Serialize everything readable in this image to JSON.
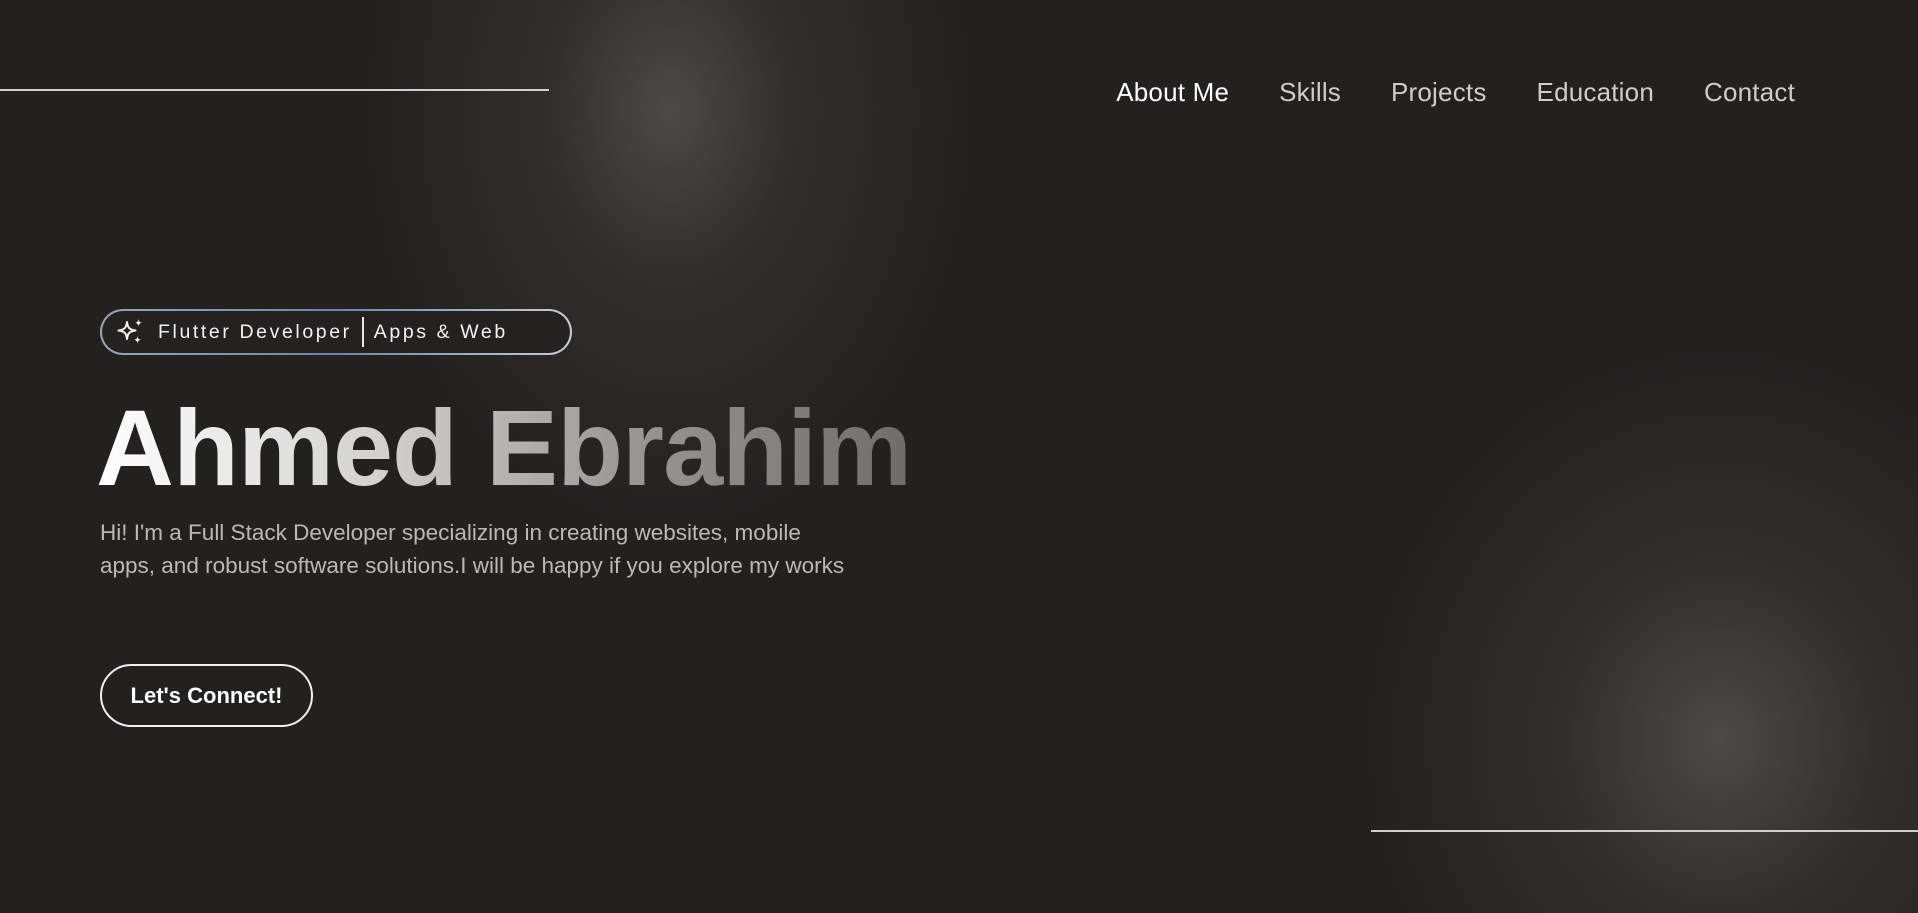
{
  "nav": {
    "items": [
      {
        "label": "About Me",
        "active": true
      },
      {
        "label": "Skills",
        "active": false
      },
      {
        "label": "Projects",
        "active": false
      },
      {
        "label": "Education",
        "active": false
      },
      {
        "label": "Contact",
        "active": false
      }
    ]
  },
  "hero": {
    "badge": {
      "icon": "sparkles-icon",
      "role": "Flutter Developer",
      "focus": "Apps & Web"
    },
    "name": "Ahmed Ebrahim",
    "intro": "Hi! I'm a Full Stack Developer specializing in creating websites, mobile apps, and robust software solutions.I will be happy if you explore my works",
    "cta_label": "Let's Connect!"
  },
  "colors": {
    "background": "#232020",
    "text_primary": "#ffffff",
    "text_muted": "#bcb8b6",
    "badge_border": "#6b86a3"
  }
}
